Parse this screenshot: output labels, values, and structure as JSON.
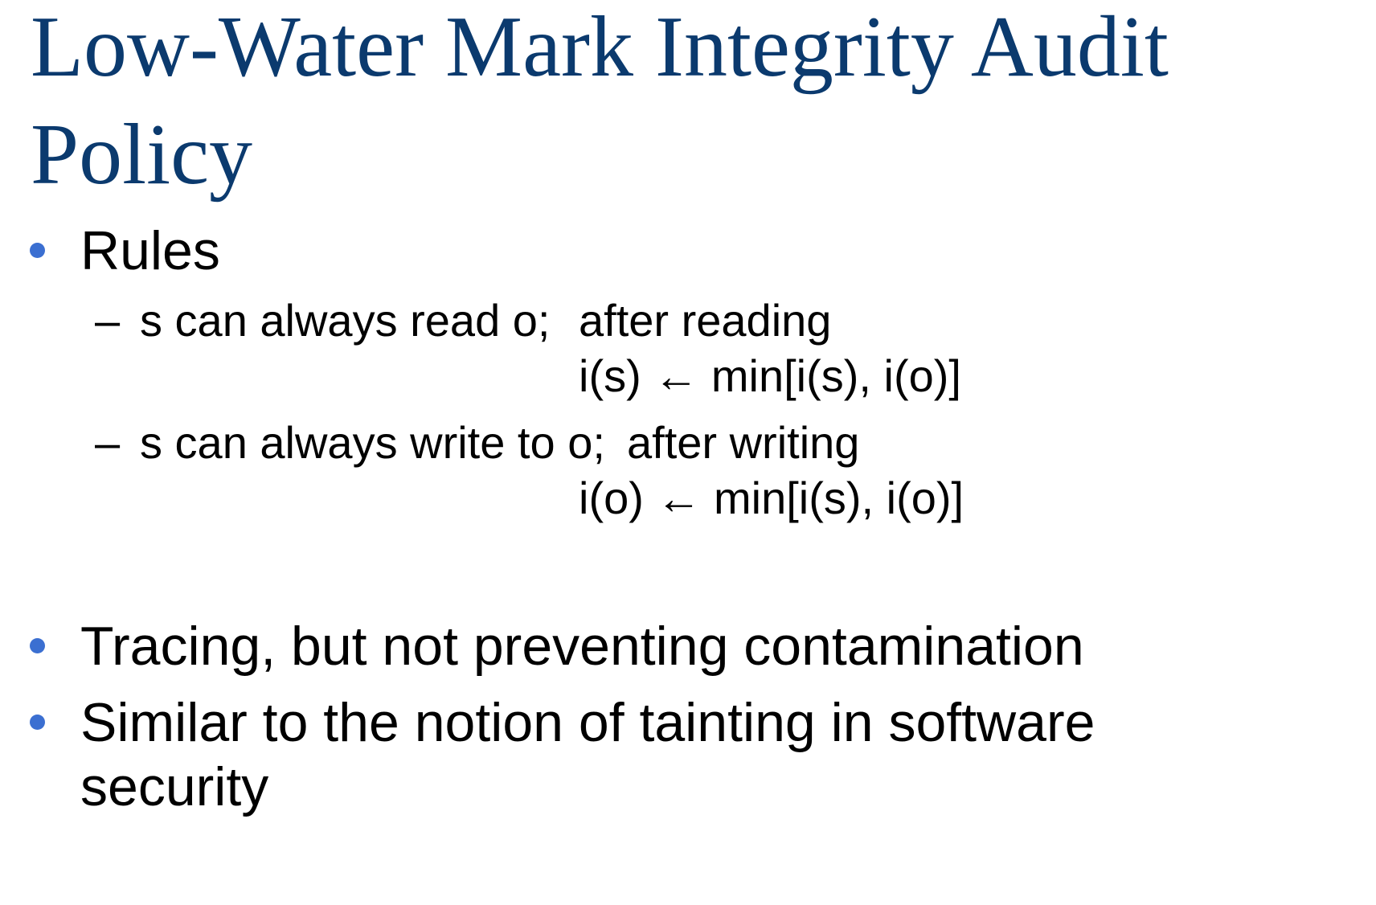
{
  "slide": {
    "title": "Low-Water Mark Integrity Audit Policy",
    "bullets": [
      {
        "text": "Rules",
        "sub_items": [
          {
            "text": "s can always read o;",
            "continuation": "after reading",
            "formula": "i(s) ← min[i(s), i(o)]"
          },
          {
            "text": "s can always write to o;",
            "continuation": "after writing",
            "formula": "i(o) ← min[i(s), i(o)]"
          }
        ]
      },
      {
        "text": "Tracing, but not preventing contamination"
      },
      {
        "text": "Similar to the notion of tainting in software",
        "continuation": "security"
      }
    ],
    "dash_glyph": "–"
  },
  "colors": {
    "title": "#0b3a6e",
    "bullet_dot": "#3b6fd1",
    "body_text": "#000000",
    "background": "#ffffff"
  }
}
